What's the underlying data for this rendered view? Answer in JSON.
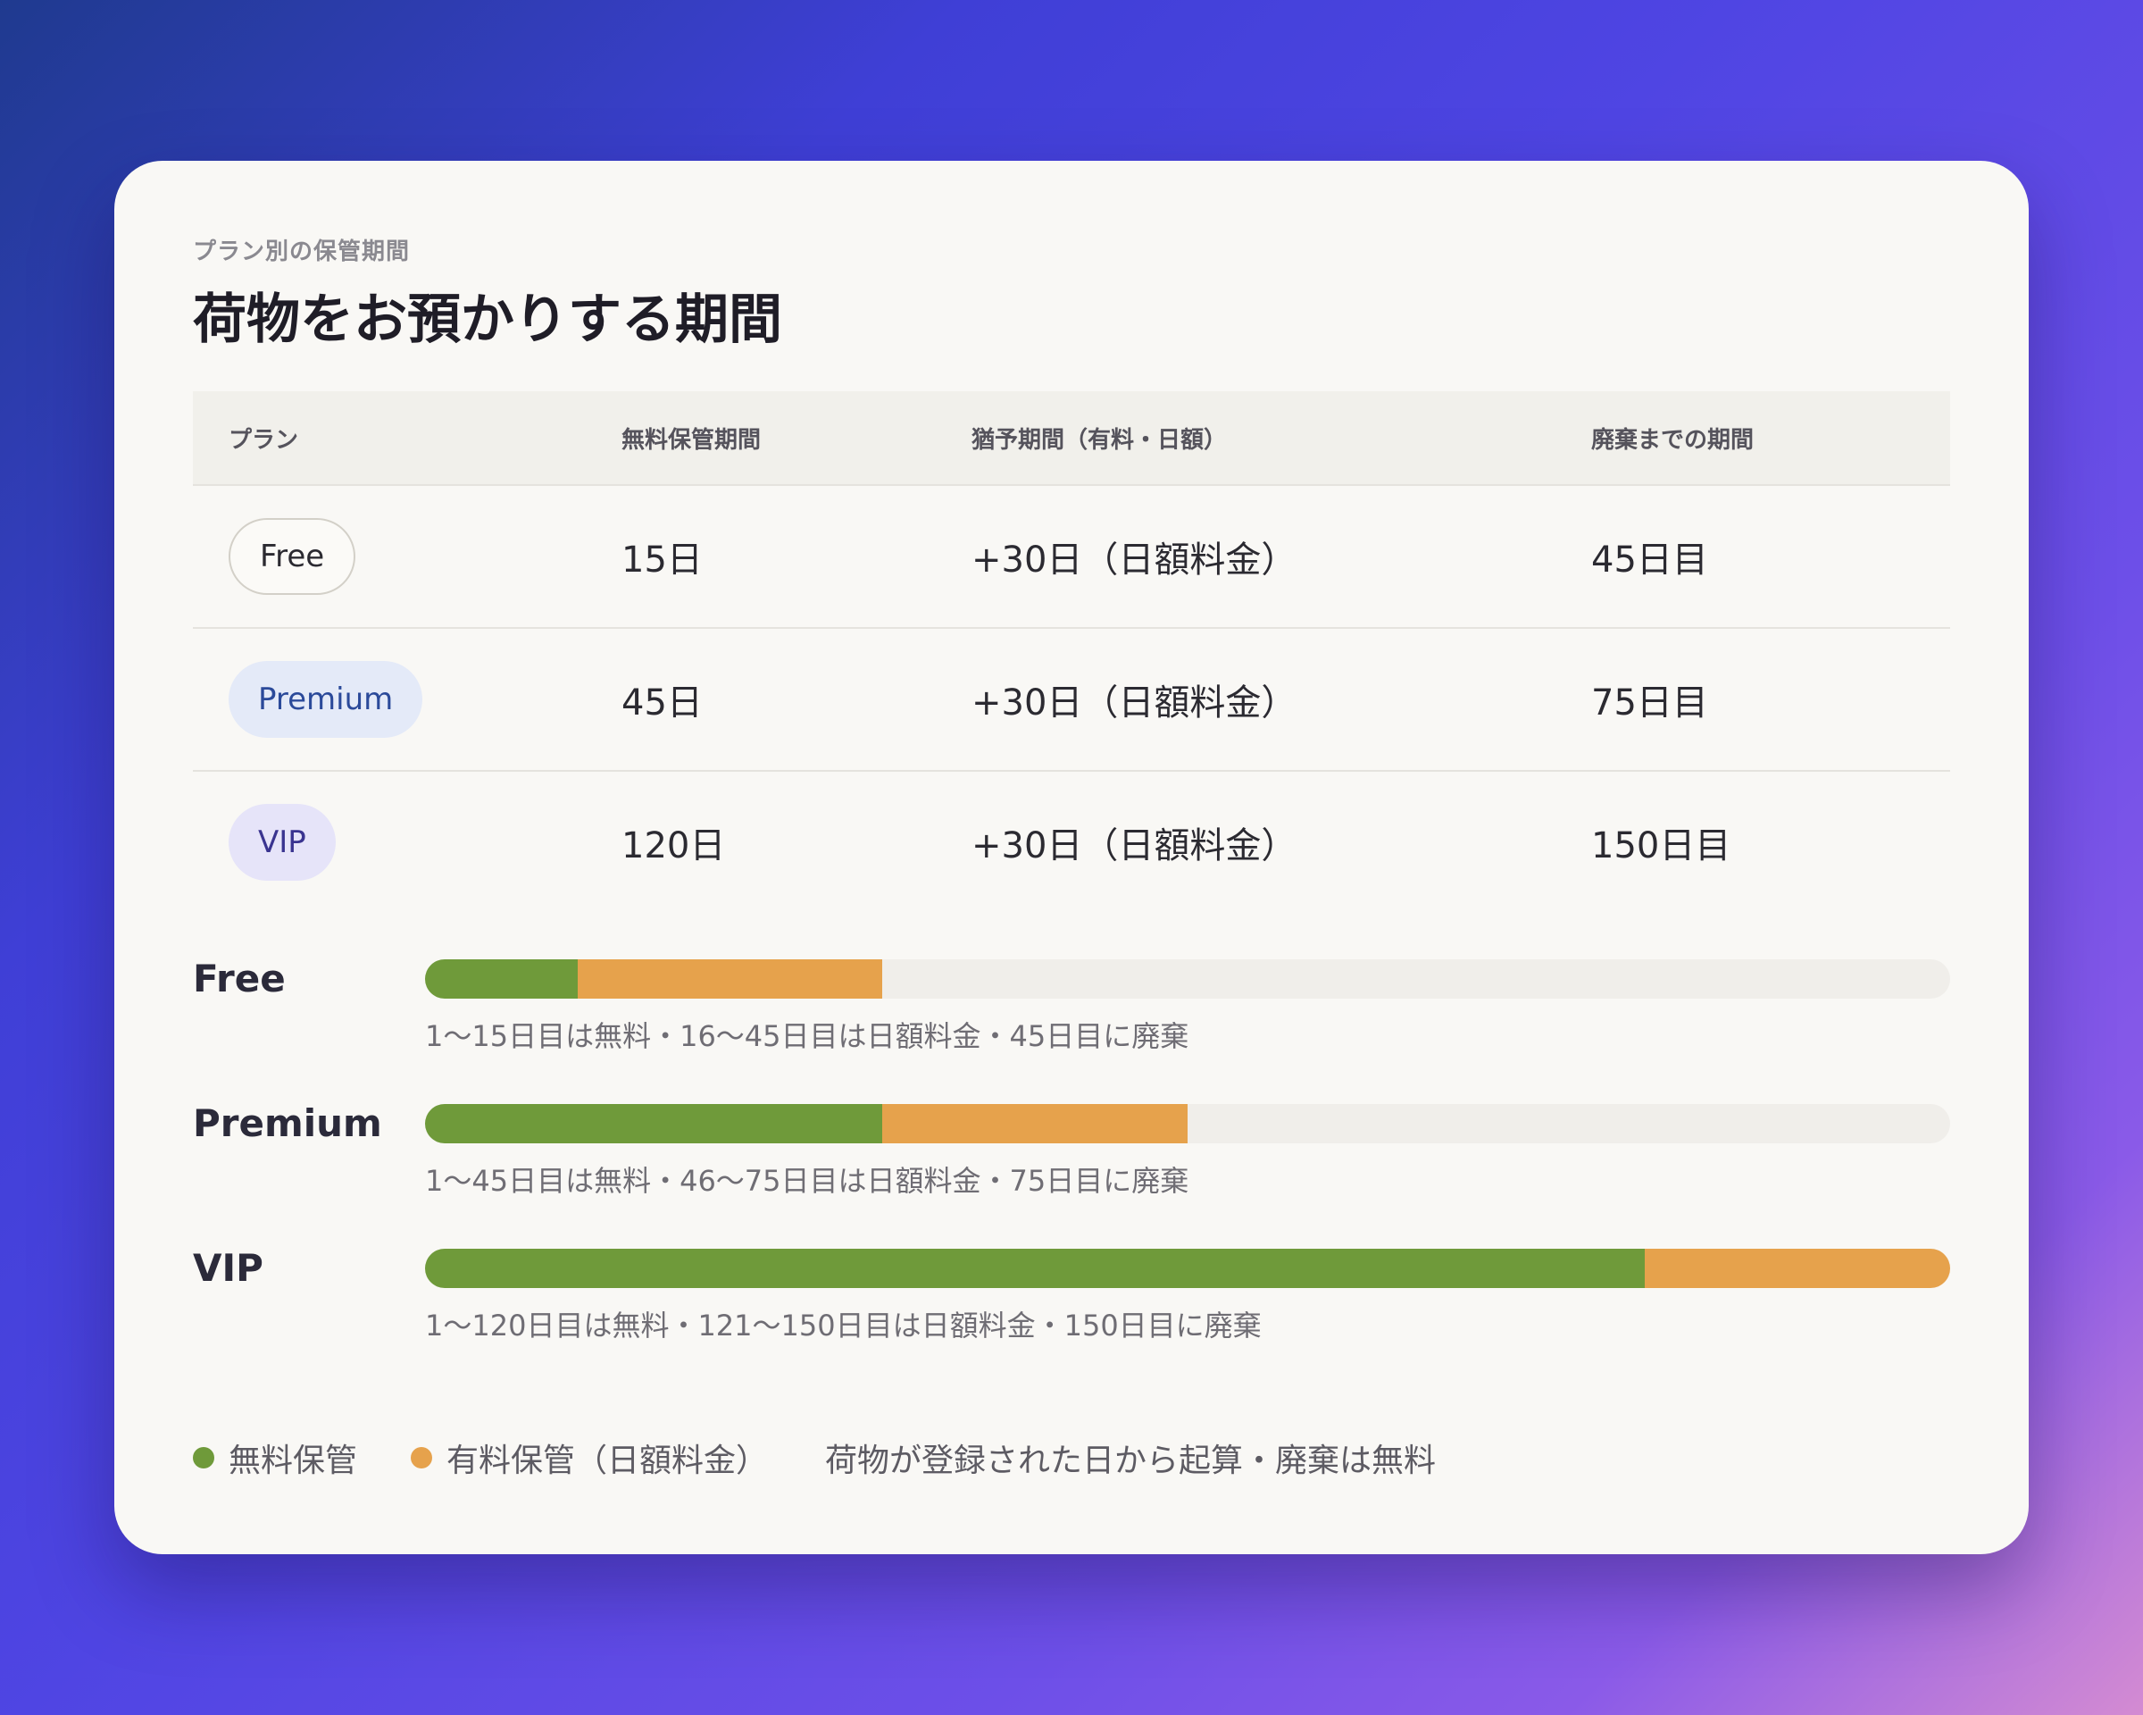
{
  "card": {
    "eyebrow": "プラン別の保管期間",
    "title": "荷物をお預かりする期間"
  },
  "table": {
    "headers": [
      "プラン",
      "無料保管期間",
      "猶予期間（有料・日額）",
      "廃棄までの期間"
    ],
    "rows": [
      {
        "plan": "Free",
        "free_period": "15日",
        "grace": "+30日（日額料金）",
        "disposal": "45日目"
      },
      {
        "plan": "Premium",
        "free_period": "45日",
        "grace": "+30日（日額料金）",
        "disposal": "75日目"
      },
      {
        "plan": "VIP",
        "free_period": "120日",
        "grace": "+30日（日額料金）",
        "disposal": "150日目"
      }
    ]
  },
  "timeline": {
    "scale_max_days": 150,
    "rows": [
      {
        "label": "Free",
        "free_days": 15,
        "paid_days": 30,
        "caption": "1〜15日目は無料・16〜45日目は日額料金・45日目に廃棄"
      },
      {
        "label": "Premium",
        "free_days": 45,
        "paid_days": 30,
        "caption": "1〜45日目は無料・46〜75日目は日額料金・75日目に廃棄"
      },
      {
        "label": "VIP",
        "free_days": 120,
        "paid_days": 30,
        "caption": "1〜120日目は無料・121〜150日目は日額料金・150日目に廃棄"
      }
    ]
  },
  "legend": {
    "free_label": "無料保管",
    "paid_label": "有料保管（日額料金）",
    "note": "荷物が登録された日から起算・廃棄は無料"
  },
  "colors": {
    "free": "#6f9a3a",
    "paid": "#e6a24c",
    "track": "#f0eeea"
  }
}
